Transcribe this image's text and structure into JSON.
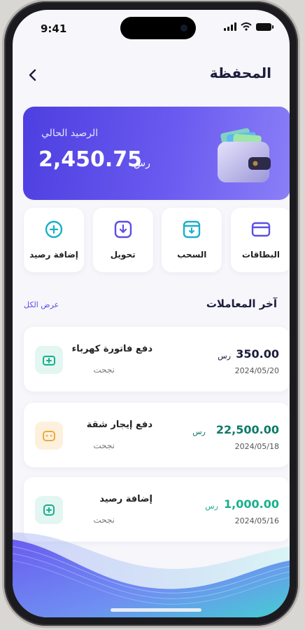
{
  "status": {
    "time": "9:41"
  },
  "header": {
    "title": "المحفظة"
  },
  "balance": {
    "label": "الرصيد الحالي",
    "amount": "2,450.75",
    "currency": "رس"
  },
  "actions": [
    {
      "label": "البطاقات",
      "icon": "card-icon"
    },
    {
      "label": "السحب",
      "icon": "withdraw-icon"
    },
    {
      "label": "تحويل",
      "icon": "transfer-icon"
    },
    {
      "label": "إضافة رصيد",
      "icon": "add-balance-icon"
    }
  ],
  "transactions_section": {
    "title": "آخر المعاملات",
    "view_all": "عرض الكل"
  },
  "transactions": [
    {
      "name": "دفع فاتورة كهرباء",
      "status": "نجحت",
      "amount": "350.00",
      "currency": "رس",
      "date": "2024/05/20",
      "icon": "electricity-bill-icon",
      "color": "#1c1c3c"
    },
    {
      "name": "دفع إيجار شقة",
      "status": "نجحت",
      "amount": "22,500.00",
      "currency": "رس",
      "date": "2024/05/18",
      "icon": "rent-icon",
      "color": "#0f7a6a"
    },
    {
      "name": "إضافة رصيد",
      "status": "نجحت",
      "amount": "1,000.00",
      "currency": "رس",
      "date": "2024/05/16",
      "icon": "add-funds-icon",
      "color": "#19b08c"
    }
  ],
  "colors": {
    "accent": "#5b4ee8",
    "card_gradient_start": "#4d3fe0",
    "card_gradient_end": "#8b7ff7",
    "positive": "#19b08c"
  }
}
